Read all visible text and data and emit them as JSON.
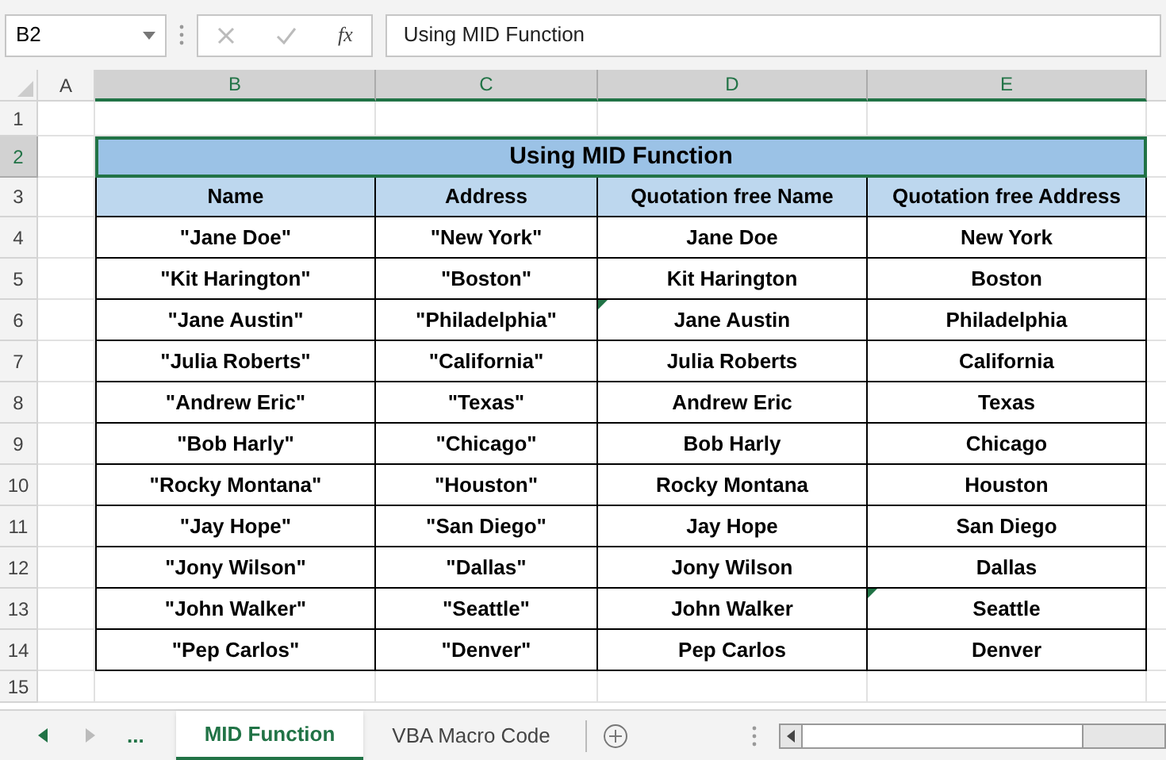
{
  "name_box": "B2",
  "formula": "Using MID Function",
  "fx": "fx",
  "column_headers": [
    {
      "label": "A",
      "selected": false
    },
    {
      "label": "B",
      "selected": true
    },
    {
      "label": "C",
      "selected": true
    },
    {
      "label": "D",
      "selected": true
    },
    {
      "label": "E",
      "selected": true
    }
  ],
  "title_row": {
    "number": "2",
    "text": "Using MID Function"
  },
  "header_row": {
    "number": "3",
    "cells": [
      "Name",
      "Address",
      "Quotation free Name",
      "Quotation free Address"
    ]
  },
  "rows": [
    {
      "number": "4",
      "cells": [
        {
          "text": "\"Jane Doe\"",
          "flagged": false
        },
        {
          "text": "\"New York\"",
          "flagged": false
        },
        {
          "text": "Jane Doe",
          "flagged": false
        },
        {
          "text": "New York",
          "flagged": false
        }
      ]
    },
    {
      "number": "5",
      "cells": [
        {
          "text": "\"Kit Harington\"",
          "flagged": false
        },
        {
          "text": "\"Boston\"",
          "flagged": false
        },
        {
          "text": "Kit Harington",
          "flagged": false
        },
        {
          "text": "Boston",
          "flagged": false
        }
      ]
    },
    {
      "number": "6",
      "cells": [
        {
          "text": "\"Jane Austin\"",
          "flagged": false
        },
        {
          "text": "\"Philadelphia\"",
          "flagged": false
        },
        {
          "text": "Jane Austin",
          "flagged": true
        },
        {
          "text": "Philadelphia",
          "flagged": false
        }
      ]
    },
    {
      "number": "7",
      "cells": [
        {
          "text": "\"Julia Roberts\"",
          "flagged": false
        },
        {
          "text": "\"California\"",
          "flagged": false
        },
        {
          "text": "Julia Roberts",
          "flagged": false
        },
        {
          "text": "California",
          "flagged": false
        }
      ]
    },
    {
      "number": "8",
      "cells": [
        {
          "text": "\"Andrew Eric\"",
          "flagged": false
        },
        {
          "text": "\"Texas\"",
          "flagged": false
        },
        {
          "text": "Andrew Eric",
          "flagged": false
        },
        {
          "text": "Texas",
          "flagged": false
        }
      ]
    },
    {
      "number": "9",
      "cells": [
        {
          "text": "\"Bob Harly\"",
          "flagged": false
        },
        {
          "text": "\"Chicago\"",
          "flagged": false
        },
        {
          "text": "Bob Harly",
          "flagged": false
        },
        {
          "text": "Chicago",
          "flagged": false
        }
      ]
    },
    {
      "number": "10",
      "cells": [
        {
          "text": "\"Rocky Montana\"",
          "flagged": false
        },
        {
          "text": "\"Houston\"",
          "flagged": false
        },
        {
          "text": "Rocky Montana",
          "flagged": false
        },
        {
          "text": "Houston",
          "flagged": false
        }
      ]
    },
    {
      "number": "11",
      "cells": [
        {
          "text": "\"Jay Hope\"",
          "flagged": false
        },
        {
          "text": "\"San Diego\"",
          "flagged": false
        },
        {
          "text": "Jay Hope",
          "flagged": false
        },
        {
          "text": "San Diego",
          "flagged": false
        }
      ]
    },
    {
      "number": "12",
      "cells": [
        {
          "text": "\"Jony Wilson\"",
          "flagged": false
        },
        {
          "text": "\"Dallas\"",
          "flagged": false
        },
        {
          "text": "Jony Wilson",
          "flagged": false
        },
        {
          "text": "Dallas",
          "flagged": false
        }
      ]
    },
    {
      "number": "13",
      "cells": [
        {
          "text": "\"John Walker\"",
          "flagged": false
        },
        {
          "text": "\"Seattle\"",
          "flagged": false
        },
        {
          "text": "John Walker",
          "flagged": false
        },
        {
          "text": "Seattle",
          "flagged": true
        }
      ]
    },
    {
      "number": "14",
      "cells": [
        {
          "text": "\"Pep Carlos\"",
          "flagged": false
        },
        {
          "text": "\"Denver\"",
          "flagged": false
        },
        {
          "text": "Pep Carlos",
          "flagged": false
        },
        {
          "text": "Denver",
          "flagged": false
        }
      ]
    }
  ],
  "empty_rows": [
    "1",
    "15"
  ],
  "more_tabs": "...",
  "sheet_tabs": [
    {
      "label": "MID Function",
      "selected": true
    },
    {
      "label": "VBA Macro Code",
      "selected": false
    }
  ]
}
